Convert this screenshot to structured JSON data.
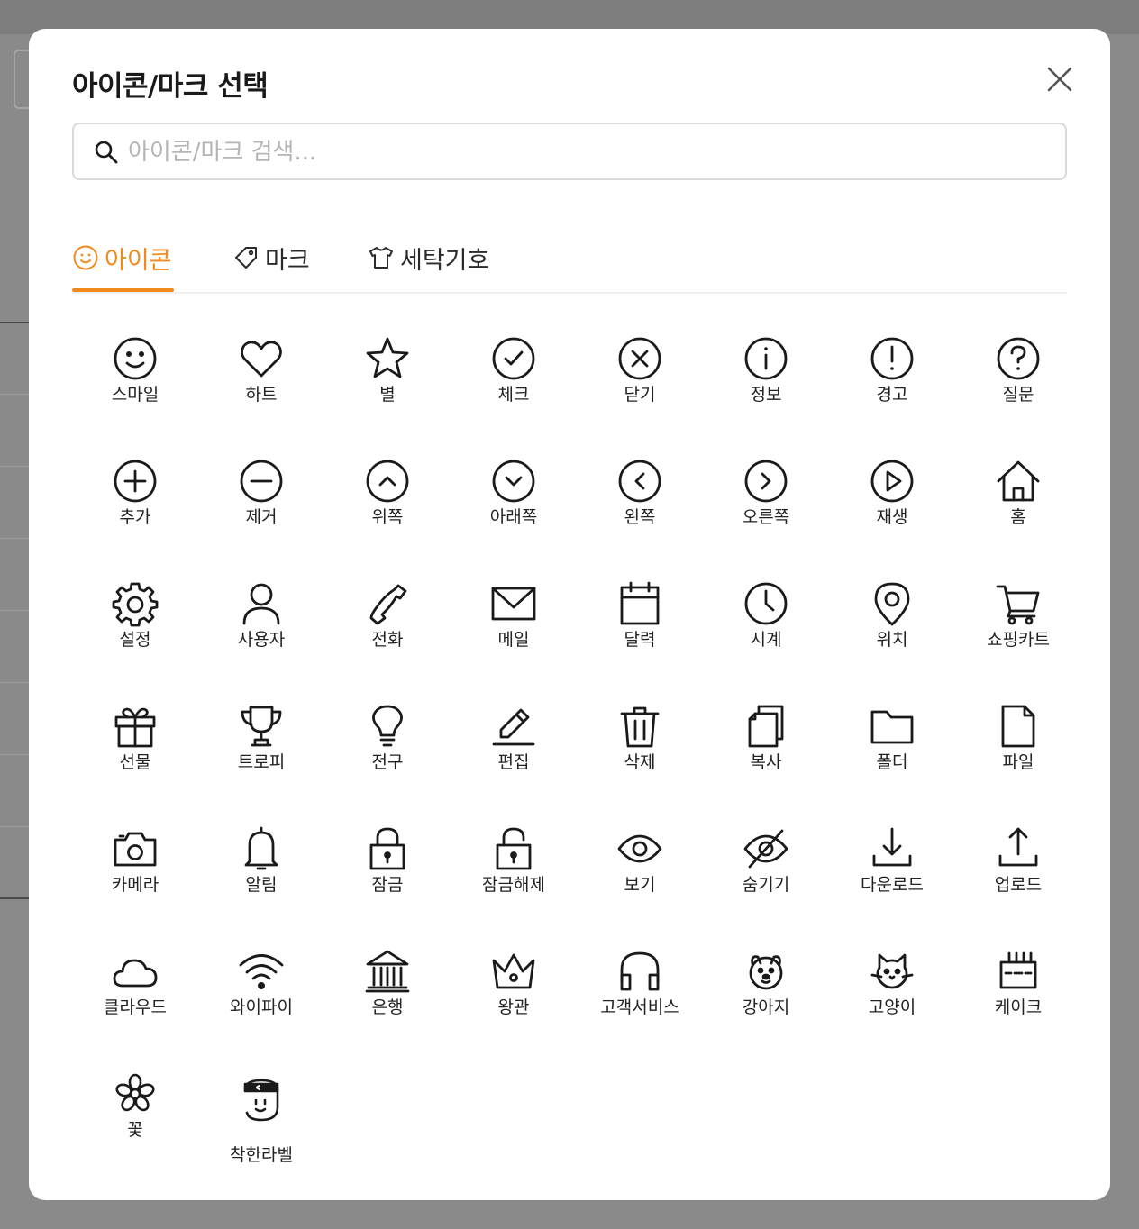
{
  "modal": {
    "title": "아이콘/마크 선택",
    "close_icon": "close-icon"
  },
  "search": {
    "placeholder": "아이콘/마크 검색...",
    "value": "",
    "icon": "search-icon"
  },
  "colors": {
    "accent": "#f08a1c",
    "text": "#1a1a1a",
    "border": "#d9d9d9",
    "placeholder": "#b5b5b5",
    "backdrop": "#8a8a8a"
  },
  "tabs": [
    {
      "label": "아이콘",
      "icon": "smile-icon",
      "active": true
    },
    {
      "label": "마크",
      "icon": "tag-icon",
      "active": false
    },
    {
      "label": "세탁기호",
      "icon": "shirt-icon",
      "active": false
    }
  ],
  "icons": [
    {
      "label": "스마일",
      "icon": "smile"
    },
    {
      "label": "하트",
      "icon": "heart"
    },
    {
      "label": "별",
      "icon": "star"
    },
    {
      "label": "체크",
      "icon": "check-circle"
    },
    {
      "label": "닫기",
      "icon": "x-circle"
    },
    {
      "label": "정보",
      "icon": "info"
    },
    {
      "label": "경고",
      "icon": "warning"
    },
    {
      "label": "질문",
      "icon": "question"
    },
    {
      "label": "추가",
      "icon": "plus-circle"
    },
    {
      "label": "제거",
      "icon": "minus-circle"
    },
    {
      "label": "위쪽",
      "icon": "chevron-up-circle"
    },
    {
      "label": "아래쪽",
      "icon": "chevron-down-circle"
    },
    {
      "label": "왼쪽",
      "icon": "chevron-left-circle"
    },
    {
      "label": "오른쪽",
      "icon": "chevron-right-circle"
    },
    {
      "label": "재생",
      "icon": "play-circle"
    },
    {
      "label": "홈",
      "icon": "home"
    },
    {
      "label": "설정",
      "icon": "gear"
    },
    {
      "label": "사용자",
      "icon": "user"
    },
    {
      "label": "전화",
      "icon": "phone"
    },
    {
      "label": "메일",
      "icon": "mail"
    },
    {
      "label": "달력",
      "icon": "calendar"
    },
    {
      "label": "시계",
      "icon": "clock"
    },
    {
      "label": "위치",
      "icon": "map-pin"
    },
    {
      "label": "쇼핑카트",
      "icon": "cart"
    },
    {
      "label": "선물",
      "icon": "gift"
    },
    {
      "label": "트로피",
      "icon": "trophy"
    },
    {
      "label": "전구",
      "icon": "lightbulb"
    },
    {
      "label": "편집",
      "icon": "edit"
    },
    {
      "label": "삭제",
      "icon": "trash"
    },
    {
      "label": "복사",
      "icon": "copy"
    },
    {
      "label": "폴더",
      "icon": "folder"
    },
    {
      "label": "파일",
      "icon": "file"
    },
    {
      "label": "카메라",
      "icon": "camera"
    },
    {
      "label": "알림",
      "icon": "bell"
    },
    {
      "label": "잠금",
      "icon": "lock"
    },
    {
      "label": "잠금해제",
      "icon": "unlock"
    },
    {
      "label": "보기",
      "icon": "eye"
    },
    {
      "label": "숨기기",
      "icon": "eye-off"
    },
    {
      "label": "다운로드",
      "icon": "download"
    },
    {
      "label": "업로드",
      "icon": "upload"
    },
    {
      "label": "클라우드",
      "icon": "cloud"
    },
    {
      "label": "와이파이",
      "icon": "wifi"
    },
    {
      "label": "은행",
      "icon": "bank"
    },
    {
      "label": "왕관",
      "icon": "crown"
    },
    {
      "label": "고객서비스",
      "icon": "headset"
    },
    {
      "label": "강아지",
      "icon": "dog"
    },
    {
      "label": "고양이",
      "icon": "cat"
    },
    {
      "label": "케이크",
      "icon": "cake"
    },
    {
      "label": "꽃",
      "icon": "flower"
    },
    {
      "label": "착한라벨",
      "icon": "good-label-mascot"
    }
  ]
}
